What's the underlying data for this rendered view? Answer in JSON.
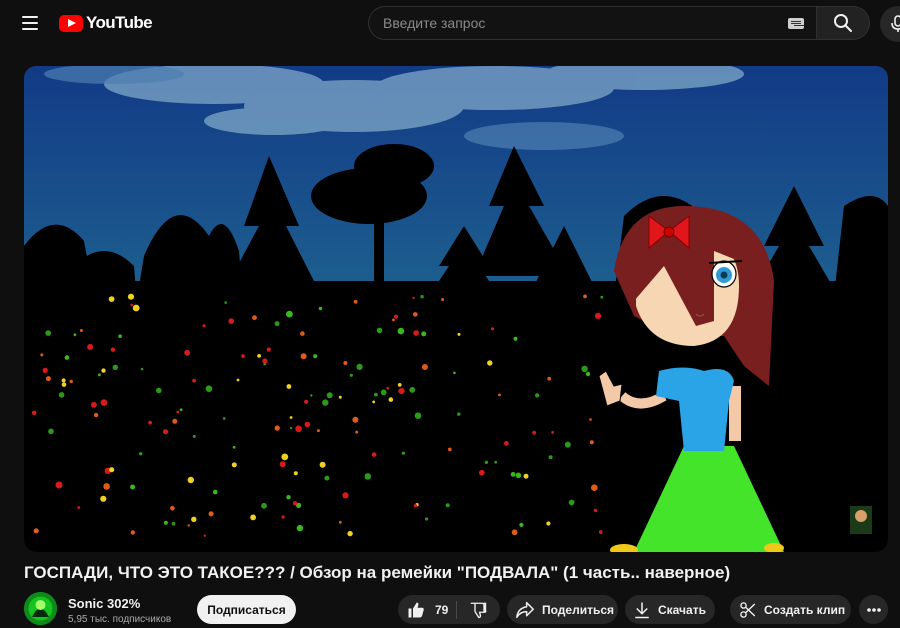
{
  "header": {
    "logo_text": "YouTube",
    "search_placeholder": "Введите запрос",
    "search_value": ""
  },
  "video": {
    "title": "ГОСПАДИ, ЧТО ЭТО ТАКОЕ??? / Обзор на ремейки \"ПОДВАЛА\" (1 часть.. наверное)"
  },
  "channel": {
    "name": "Sonic 302%",
    "subscribers": "5,95 тыс. подписчиков",
    "subscribe_label": "Подписаться"
  },
  "actions": {
    "like_count": "79",
    "share_label": "Поделиться",
    "download_label": "Скачать",
    "clip_label": "Создать клип"
  },
  "colors": {
    "background": "#0f0f0f",
    "brand_red": "#ff0000",
    "pill_bg": "#272727",
    "subscribe_bg": "#f1f1f1"
  },
  "icons": [
    "menu-icon",
    "youtube-logo-icon",
    "keyboard-icon",
    "search-icon",
    "mic-icon",
    "like-icon",
    "dislike-icon",
    "share-icon",
    "download-icon",
    "scissors-icon",
    "more-icon"
  ]
}
